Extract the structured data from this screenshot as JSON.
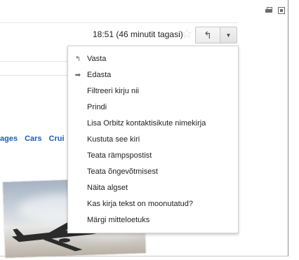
{
  "header": {
    "timestamp": "18:51 (46 minutit tagasi)",
    "star_glyph": "☆",
    "reply_glyph": "↰",
    "more_glyph": "▼",
    "icons": [
      "print-icon",
      "new-window-icon"
    ]
  },
  "nav": {
    "items": [
      "ages",
      "Cars",
      "Crui"
    ]
  },
  "menu": {
    "items": [
      {
        "label": "Vasta",
        "icon": "reply-icon",
        "glyph": "↰"
      },
      {
        "label": "Edasta",
        "icon": "forward-icon",
        "glyph": "➡"
      },
      {
        "label": "Filtreeri kirju nii",
        "icon": "",
        "glyph": ""
      },
      {
        "label": "Prindi",
        "icon": "",
        "glyph": ""
      },
      {
        "label": "Lisa Orbitz kontaktisikute nimekirja",
        "icon": "",
        "glyph": ""
      },
      {
        "label": "Kustuta see kiri",
        "icon": "",
        "glyph": ""
      },
      {
        "label": "Teata rämpspostist",
        "icon": "",
        "glyph": ""
      },
      {
        "label": "Teata õngevõtmisest",
        "icon": "",
        "glyph": ""
      },
      {
        "label": "Näita algset",
        "icon": "",
        "glyph": ""
      },
      {
        "label": "Kas kirja tekst on moonutatud?",
        "icon": "",
        "glyph": ""
      },
      {
        "label": "Märgi mitteloetuks",
        "icon": "",
        "glyph": ""
      }
    ]
  },
  "colors": {
    "nav_link": "#1a5fb4",
    "star": "#d8d8d8"
  }
}
